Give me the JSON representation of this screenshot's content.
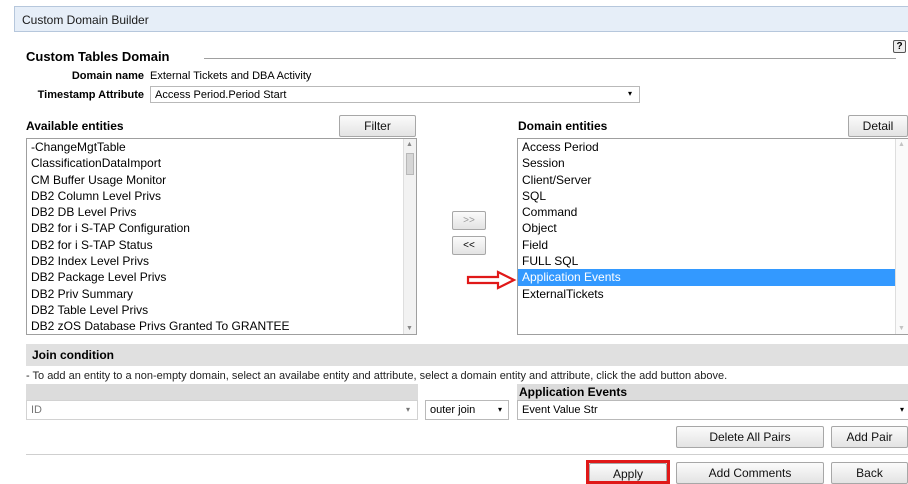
{
  "window": {
    "title": "Custom Domain Builder"
  },
  "domain": {
    "heading": "Custom Tables Domain",
    "help_icon": "?",
    "name_label": "Domain name",
    "name_value": "External Tickets and DBA Activity",
    "timestamp_label": "Timestamp Attribute",
    "timestamp_value": "Access Period.Period Start"
  },
  "available": {
    "label": "Available entities",
    "filter_button": "Filter",
    "items": [
      "-ChangeMgtTable",
      "ClassificationDataImport",
      "CM Buffer Usage Monitor",
      "DB2 Column Level Privs",
      "DB2 DB Level Privs",
      "DB2 for i S-TAP Configuration",
      "DB2 for i S-TAP Status",
      "DB2 Index Level Privs",
      "DB2 Package Level Privs",
      "DB2 Priv Summary",
      "DB2 Table Level Privs",
      "DB2 zOS Database Privs Granted To GRANTEE"
    ]
  },
  "transfer": {
    "add_label": ">>",
    "remove_label": "<<"
  },
  "domain_entities": {
    "label": "Domain entities",
    "detail_button": "Detail",
    "items": [
      "Access Period",
      "Session",
      "Client/Server",
      "SQL",
      "Command",
      "Object",
      "Field",
      "FULL SQL",
      "Application Events",
      "ExternalTickets"
    ],
    "selected": "Application Events"
  },
  "join": {
    "heading": "Join condition",
    "hint": "- To add an entity to a non-empty domain, select an availabe entity and attribute, select a domain entity and attribute, click the add button above.",
    "right_entity": "Application Events",
    "left_attribute": "ID",
    "join_type": "outer join",
    "right_attribute": "Event Value Str",
    "delete_all_button": "Delete All Pairs",
    "add_pair_button": "Add Pair"
  },
  "footer": {
    "apply_button": "Apply",
    "add_comments_button": "Add Comments",
    "back_button": "Back"
  },
  "colors": {
    "selection": "#3399ff",
    "annotation_red": "#e01818",
    "titlebar_bg": "#e6eef8"
  },
  "icons": {
    "down_arrow": "▾",
    "scroll_up": "▲",
    "scroll_down": "▼"
  }
}
